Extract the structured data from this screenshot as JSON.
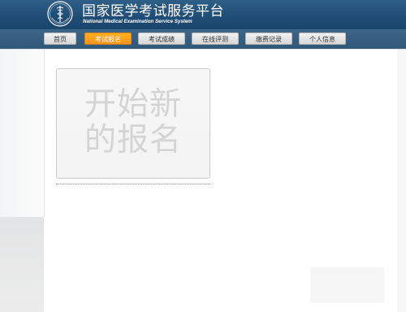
{
  "header": {
    "title_cn": "国家医学考试服务平台",
    "title_en": "National Medical Examination Service System",
    "logo_icon": "medical-caduceus-emblem-icon"
  },
  "nav": {
    "items": [
      {
        "label": "首页",
        "active": false
      },
      {
        "label": "考试报名",
        "active": true
      },
      {
        "label": "考试成绩",
        "active": false
      },
      {
        "label": "在线评测",
        "active": false
      },
      {
        "label": "缴费记录",
        "active": false
      },
      {
        "label": "个人信息",
        "active": false
      }
    ],
    "active_color": "#f7941d"
  },
  "main": {
    "start_card": {
      "line1": "开始新",
      "line2": "的报名"
    }
  },
  "colors": {
    "header_bg": "#1f4c74",
    "nav_bg": "#305878",
    "card_text": "#d4d4d4"
  }
}
